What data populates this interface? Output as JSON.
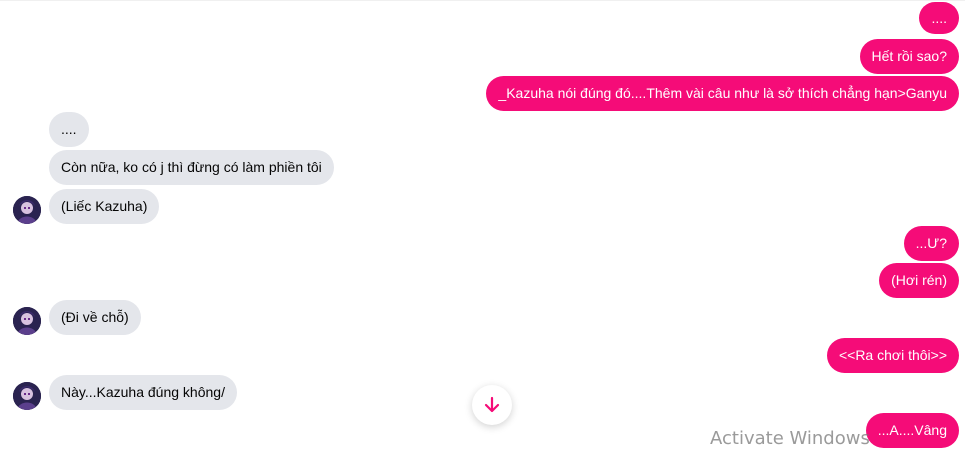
{
  "messages": {
    "out_1": "....",
    "out_2": "Hết rồi sao?",
    "out_3": "_Kazuha nói đúng đó....Thêm vài câu như là sở thích chẳng hạn>Ganyu",
    "in_1": "....",
    "in_2": "Còn nữa, ko có j thì đừng có làm phiền tôi",
    "in_3": "(Liếc Kazuha)",
    "out_4": "...Ư?",
    "out_5": "(Hơi rén)",
    "in_4": "(Đi về chỗ)",
    "out_6": "<<Ra chơi thôi>>",
    "in_5": "Này...Kazuha đúng không/",
    "out_7": "...A....Vâng"
  },
  "watermark": "Activate Windows",
  "icons": {
    "scroll_down": "arrow-down-icon",
    "avatar": "avatar"
  },
  "colors": {
    "outgoing_bubble": "#f50c78",
    "incoming_bubble": "#e4e6eb",
    "accent": "#f50c78"
  }
}
